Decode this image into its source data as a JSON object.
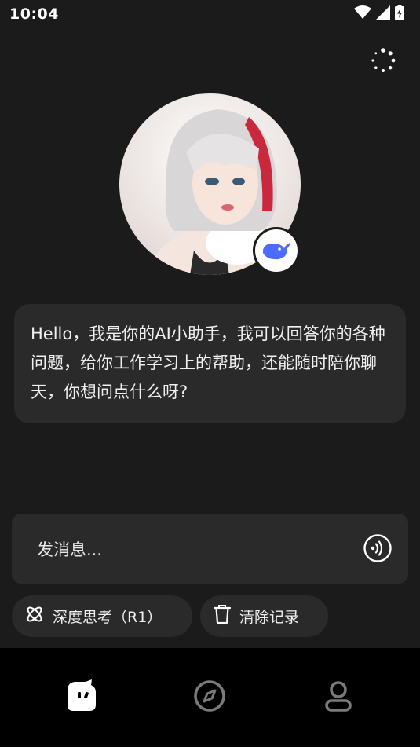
{
  "status_bar": {
    "time": "10:04"
  },
  "assistant": {
    "greeting": "Hello，我是你的AI小助手，我可以回答你的各种问题，给你工作学习上的帮助，还能随时陪你聊天，你想问点什么呀?"
  },
  "input": {
    "placeholder": "发消息..."
  },
  "chips": {
    "deep_think": "深度思考（R1）",
    "clear": "清除记录"
  },
  "icons": {
    "loading": "loading-dots-icon",
    "voice": "voice-wave-icon",
    "deep_think": "atom-icon",
    "clear": "trash-icon",
    "badge": "whale-icon",
    "nav_chat": "chat-bot-icon",
    "nav_discover": "compass-icon",
    "nav_profile": "person-icon"
  },
  "colors": {
    "background": "#1b1b1b",
    "card": "#2a2a2a",
    "badge_blue": "#4d6bfe",
    "nav_bg": "#000000"
  }
}
